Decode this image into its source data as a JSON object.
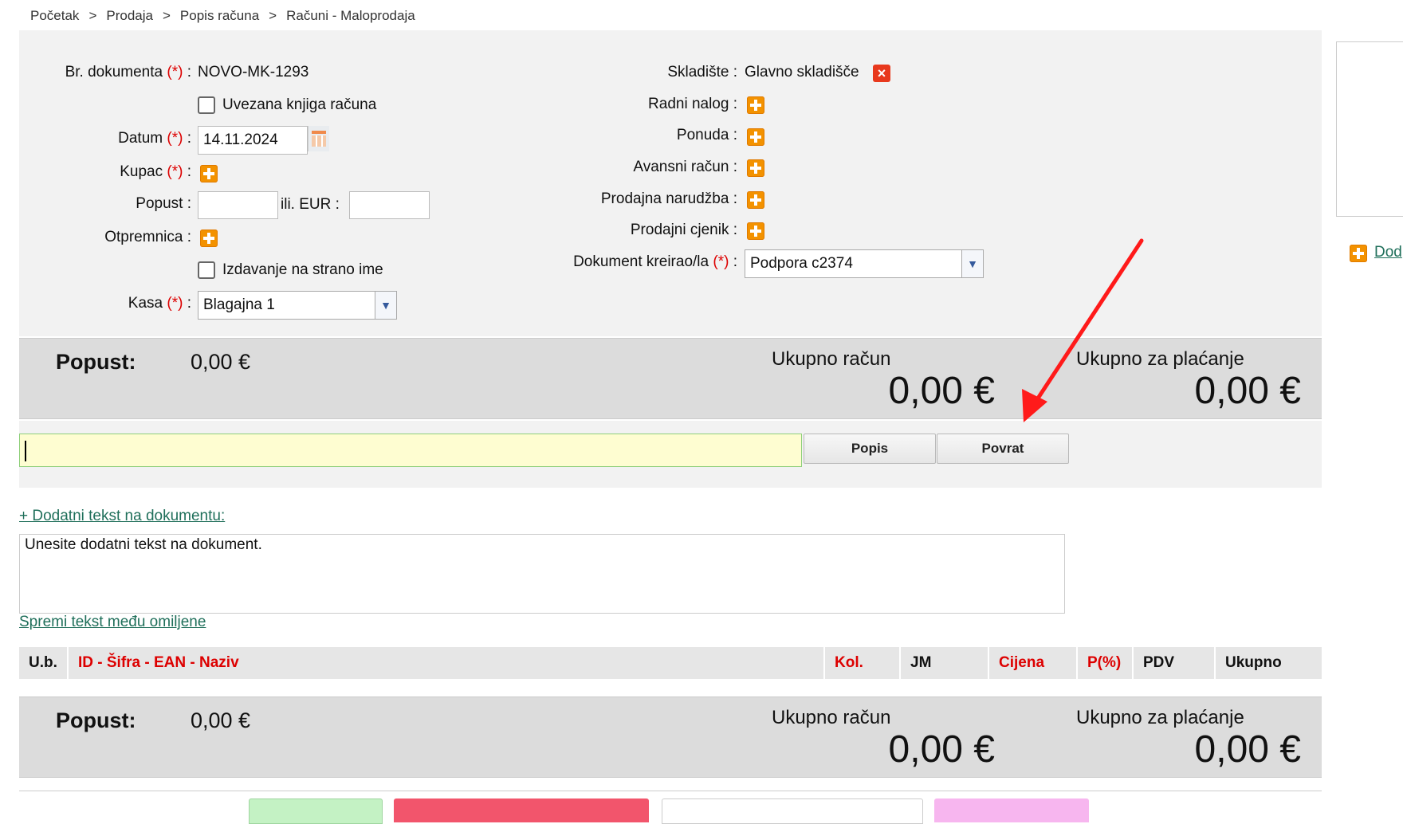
{
  "breadcrumb": [
    "Početak",
    "Prodaja",
    "Popis računa",
    "Računi - Maloprodaja"
  ],
  "breadcrumb_separator": ">",
  "required_marker": "(*)",
  "form_left": {
    "doc_number_label": "Br. dokumenta",
    "doc_number_value": "NOVO-MK-1293",
    "bound_book_label": "Uvezana knjiga računa",
    "date_label": "Datum",
    "date_value": "14.11.2024",
    "buyer_label": "Kupac",
    "discount_label": "Popust :",
    "discount_or_label": "ili. EUR :",
    "delivery_note_label": "Otpremnica :",
    "foreign_name_label": "Izdavanje na strano ime",
    "cashbox_label": "Kasa",
    "cashbox_value": "Blagajna 1"
  },
  "form_right": {
    "warehouse_label": "Skladište :",
    "warehouse_value": "Glavno skladišče",
    "work_order_label": "Radni nalog :",
    "offer_label": "Ponuda :",
    "advance_invoice_label": "Avansni račun :",
    "sales_order_label": "Prodajna narudžba :",
    "sales_pricelist_label": "Prodajni cjenik :",
    "created_by_label": "Dokument kreirao/la",
    "created_by_value": "Podpora c2374"
  },
  "totals": {
    "discount_label": "Popust:",
    "discount_value": "0,00 €",
    "invoice_total_label": "Ukupno račun",
    "invoice_total_value": "0,00 €",
    "payable_label": "Ukupno za plaćanje",
    "payable_value": "0,00 €"
  },
  "scan": {
    "list_button": "Popis",
    "return_button": "Povrat"
  },
  "extra_text": {
    "toggle_link": "+ Dodatni tekst na dokumentu:",
    "placeholder": "Unesite dodatni tekst na dokument.",
    "save_favorite_link": "Spremi tekst među omiljene"
  },
  "table": {
    "columns": [
      "U.b.",
      "ID - Šifra - EAN - Naziv",
      "Kol.",
      "JM",
      "Cijena",
      "P(%)",
      "PDV",
      "Ukupno"
    ]
  },
  "side": {
    "add_link": "Dod"
  },
  "colors": {
    "required": "#dd0000",
    "scan_bg": "#fefdd1",
    "link": "#1f6f5a",
    "plus": "#f39200",
    "annotation_arrow": "#ff1a1a"
  }
}
